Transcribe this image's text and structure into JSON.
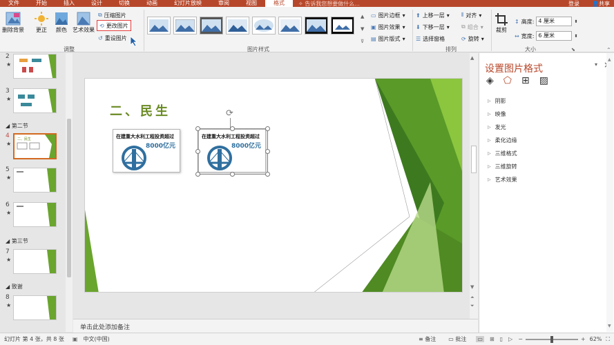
{
  "tabs": [
    "文件",
    "开始",
    "插入",
    "设计",
    "切换",
    "动画",
    "幻灯片放映",
    "审阅",
    "视图",
    "格式"
  ],
  "active_tab": "格式",
  "tell_me": "告诉我您想要做什么...",
  "account": {
    "login": "登录",
    "share": "共享"
  },
  "ribbon": {
    "adjust": {
      "remove_bg": "删除背景",
      "correct": "更正",
      "color": "颜色",
      "artistic": "艺术效果",
      "compress": "压缩图片",
      "change": "更改图片",
      "reset": "重设图片",
      "group_label": "调整"
    },
    "styles_label": "图片样式",
    "style_options": {
      "border": "图片边框",
      "effects": "图片效果",
      "layout": "图片版式"
    },
    "arrange": {
      "forward": "上移一层",
      "backward": "下移一层",
      "pane": "选择窗格",
      "align": "对齐",
      "group": "组合",
      "rotate": "旋转",
      "group_label": "排列"
    },
    "size": {
      "crop": "裁剪",
      "height_label": "高度:",
      "height_value": "4 厘米",
      "width_label": "宽度:",
      "width_value": "6 厘米",
      "group_label": "大小"
    }
  },
  "slides_panel": {
    "items": [
      {
        "num": "2"
      },
      {
        "num": "3"
      },
      {
        "num": "4"
      },
      {
        "num": "5"
      },
      {
        "num": "6"
      },
      {
        "num": "7"
      },
      {
        "num": "8"
      }
    ],
    "sections": [
      "第二节",
      "第三节",
      "致谢"
    ]
  },
  "slide": {
    "title": "二、民生",
    "card_title": "在建重大水利工程投资超过",
    "card_value": "8000亿元"
  },
  "notes_placeholder": "单击此处添加备注",
  "status": {
    "slide_info": "幻灯片 第 4 张，共 8 张",
    "language": "中文(中国)",
    "notes": "备注",
    "comments": "批注",
    "zoom": "62%"
  },
  "format_pane": {
    "title": "设置图片格式",
    "items": [
      "阴影",
      "映像",
      "发光",
      "柔化边缘",
      "三维格式",
      "三维旋转",
      "艺术效果"
    ]
  },
  "colors": {
    "accent": "#b7472a",
    "title_green": "#6a8a23",
    "green_dark": "#3d7a1f",
    "green_light": "#9ccc3c"
  }
}
